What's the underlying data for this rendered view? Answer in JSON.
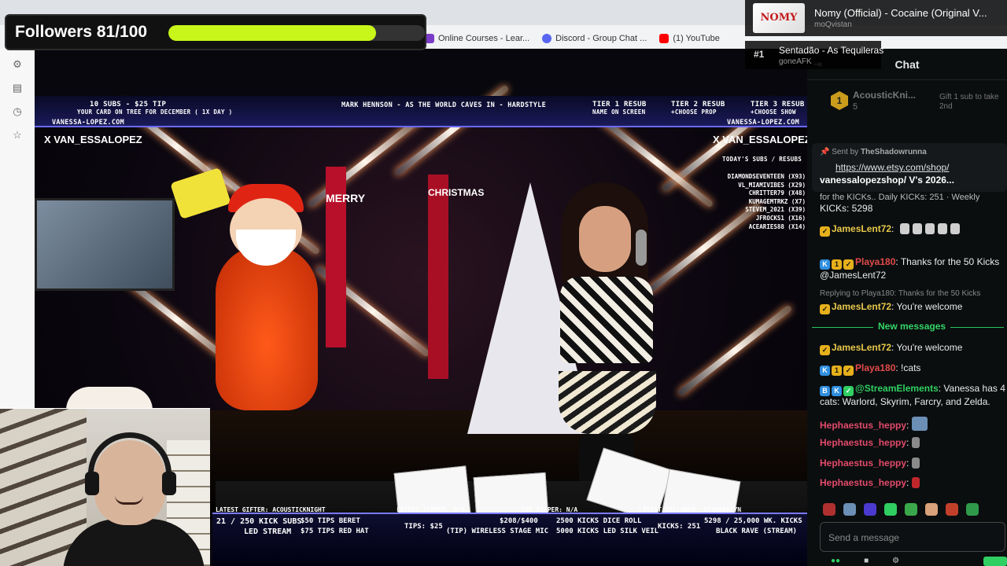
{
  "followers": {
    "label": "Followers 81/100",
    "progress": 0.81,
    "color": "#c8f51a"
  },
  "bookmarks": [
    {
      "label": "Online Courses - Lear...",
      "color": "#7a3cc7"
    },
    {
      "label": "Discord - Group Chat ...",
      "color": "#5865f2"
    },
    {
      "label": "(1) YouTube",
      "color": "#ff0000"
    }
  ],
  "music": {
    "now_art": "NOMY",
    "now_title": "Nomy (Official) - Cocaine (Original V...",
    "now_artist": "moQvistan",
    "queue_rank": "#1",
    "queue_title": "Sentadão - As Tequileras",
    "queue_artist": "goneAFK"
  },
  "stream": {
    "top_left_1": "10 SUBS - $25 TIP",
    "top_left_2": "YOUR CARD ON TREE FOR DECEMBER ( 1X DAY )",
    "top_center": "MARK HENNSON - AS THE WORLD CAVES IN - HARDSTYLE",
    "tier1_a": "TIER 1 RESUB",
    "tier1_b": "NAME ON SCREEN",
    "tier2_a": "TIER 2 RESUB",
    "tier2_b": "+CHOOSE PROP",
    "tier3_a": "TIER 3 RESUB",
    "tier3_b": "+CHOOSE SHOW",
    "site_left": "VANESSA-LOPEZ.COM",
    "site_right": "VANESSA-LOPEZ.COM",
    "handle_left": "X VAN_ESSALOPEZ",
    "handle_right": "X VAN_ESSALOPEZ",
    "leaderboard_title": "TODAY'S SUBS / RESUBS",
    "leaderboard": [
      "DIAMONDSEVENTEEN (X93)",
      "VL_MIAMIVIBES (X29)",
      "CHRITTER79 (X48)",
      "KUMAGEMTRKZ (X7)",
      "STEVEM_2021 (X39)",
      "JFROCKS1 (X16)",
      "ACEARIES88 (X14)"
    ],
    "banner_left": "MERRY",
    "banner_right": "CHRISTMAS",
    "latest_gifter": "LATEST GIFTER: ACOUSTICKNIGHT",
    "latest_tipper": "LATEST TIPPER: N/A",
    "top_tipper": "TOP TIPPER: N/A",
    "latest_follower": "LATEST FOLLOWER: SITHAVACYN",
    "kick_subs": "21 / 250 KICK SUBS",
    "led_stream": "LED STREAM",
    "tip50": "$50  TIPS  BERET",
    "tip75": "$75  TIPS  RED HAT",
    "tips_amt": "TIPS: $25",
    "wireless": "$208/$400",
    "wireless_label": "(TIP) WIRELESS STAGE MIC",
    "kicks2500": "2500  KICKS  DICE ROLL",
    "kicks5000": "5000  KICKS  LED SILK VEIL",
    "kicks_total": "KICKS: 251",
    "wk_kicks": "5298 / 25,000 WK. KICKS",
    "black_rave": "BLACK RAVE (STREAM)"
  },
  "chat": {
    "title": "Chat",
    "top_gifter": {
      "rank": "1",
      "name": "AcousticKni...",
      "count": "5",
      "hint": "Gift 1 sub to take 2nd"
    },
    "pinned": {
      "sent_by": "Sent by",
      "sender": "TheShadowrunna",
      "link": "https://www.etsy.com/shop/",
      "text": "vanessalopezshop/ V's 2026..."
    },
    "partial_top": "for the KICKs.. Daily KICKs: 251 · Weekly",
    "kicks_line": "KICKs: 5298",
    "messages": [
      {
        "user": "JamesLent72",
        "text": ""
      },
      {
        "user": "Playa180",
        "text": ": Thanks for the 50 Kicks @JamesLent72"
      },
      {
        "reply": "Replying to Playa180: Thanks for the 50 Kicks",
        "user": "JamesLent72",
        "text": ": You're welcome"
      }
    ],
    "new_messages": "New messages",
    "messages_after": [
      {
        "user": "JamesLent72",
        "text": ": You're welcome"
      },
      {
        "user": "Playa180",
        "text": ": !cats"
      },
      {
        "user": "@StreamElements",
        "text": ": Vanessa has 4 cats: Warlord, Skyrim, Farcry, and Zelda."
      },
      {
        "user": "Hephaestus_heppy",
        "text": ":"
      },
      {
        "user": "Hephaestus_heppy",
        "text": ":"
      },
      {
        "user": "Hephaestus_heppy",
        "text": ":"
      },
      {
        "user": "Hephaestus_heppy",
        "text": ":"
      }
    ],
    "input_placeholder": "Send a message"
  }
}
